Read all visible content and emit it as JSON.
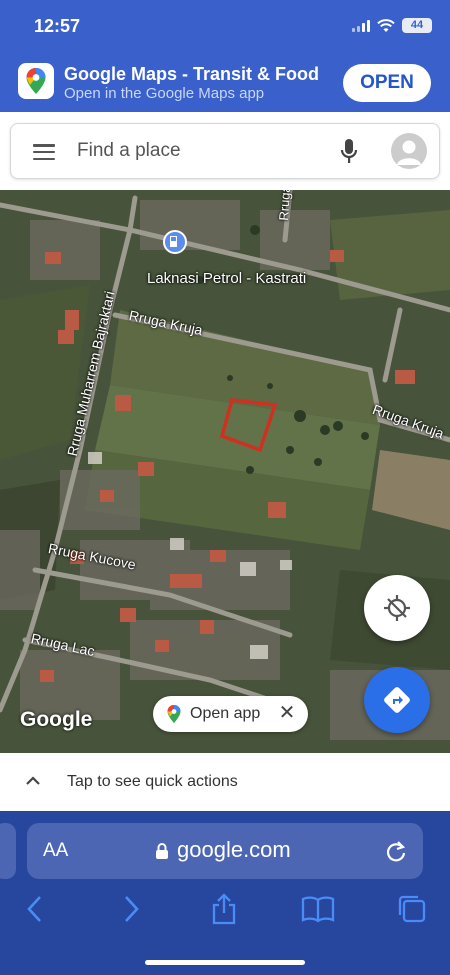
{
  "status_bar": {
    "time": "12:57",
    "battery": "44",
    "icons": [
      "signal-icon",
      "wifi-icon",
      "battery-icon"
    ]
  },
  "app_banner": {
    "title": "Google Maps - Transit & Food",
    "subtitle": "Open in the Google Maps app",
    "open_label": "OPEN",
    "icon": "google-maps-icon"
  },
  "search": {
    "placeholder": "Find a place",
    "icons": [
      "menu-icon",
      "mic-icon",
      "avatar-icon"
    ]
  },
  "map": {
    "poi_label": "Laknasi Petrol - Kastrati",
    "street_labels": {
      "pleq": "Rruga Ple",
      "kruja_1": "Rruga Kruja",
      "kruja_2": "Rruga Kruja",
      "bajraktari": "Rruga Muharrem Bajraktari",
      "kucove": "Rruga Kucove",
      "lac": "Rruga Lac"
    },
    "google_logo": "Google",
    "open_app_label": "Open app",
    "icons": [
      "gas-station-icon",
      "locate-icon",
      "directions-icon",
      "close-icon"
    ]
  },
  "quick_actions": {
    "text": "Tap to see quick actions"
  },
  "safari": {
    "aa_label": "AA",
    "url": "google.com",
    "icons": [
      "lock-icon",
      "reload-icon",
      "back-icon",
      "forward-icon",
      "share-icon",
      "bookmarks-icon",
      "tabs-icon"
    ]
  },
  "colors": {
    "banner_bg": "#3a60cc",
    "safari_bg": "#27469e",
    "directions_blue": "#2a6ee8",
    "parcel_outline": "#d0301f"
  }
}
